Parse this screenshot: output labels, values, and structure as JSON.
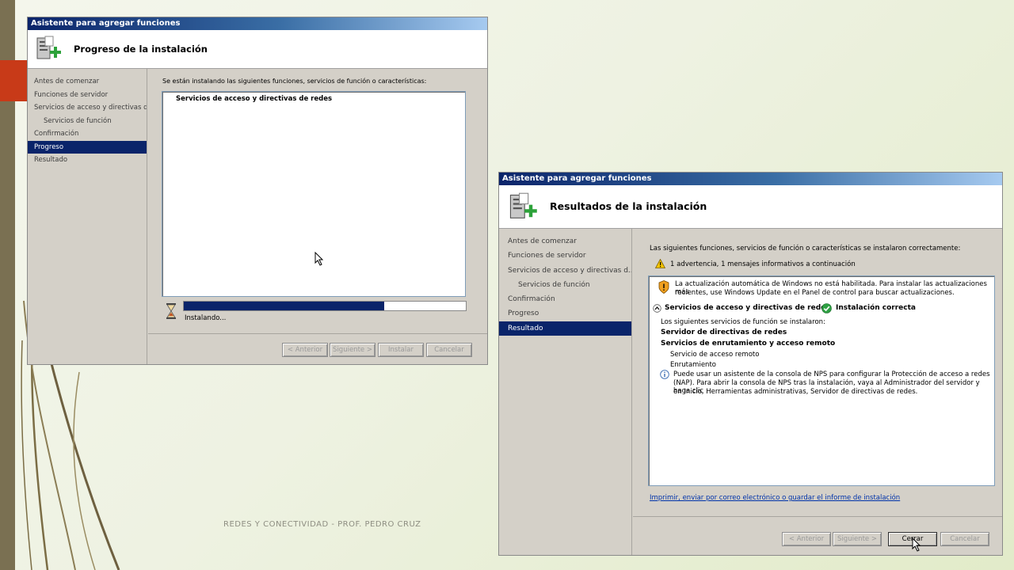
{
  "slide": {
    "footer": "REDES Y CONECTIVIDAD - PROF. PEDRO CRUZ"
  },
  "progress_window": {
    "title": "Asistente para agregar funciones",
    "header": "Progreso de la instalación",
    "nav": [
      {
        "label": "Antes de comenzar"
      },
      {
        "label": "Funciones de servidor"
      },
      {
        "label": "Servicios de acceso y directivas d..."
      },
      {
        "label": "Servicios de función"
      },
      {
        "label": "Confirmación"
      },
      {
        "label": "Progreso"
      },
      {
        "label": "Resultado"
      }
    ],
    "intro": "Se están instalando las siguientes funciones, servicios de función o características:",
    "list_item": "Servicios de acceso y directivas de redes",
    "progress": 0.71,
    "status": "Instalando...",
    "buttons": {
      "back": "< Anterior",
      "next": "Siguiente >",
      "install": "Instalar",
      "cancel": "Cancelar"
    }
  },
  "results_window": {
    "title": "Asistente para agregar funciones",
    "header": "Resultados de la instalación",
    "nav": [
      {
        "label": "Antes de comenzar"
      },
      {
        "label": "Funciones de servidor"
      },
      {
        "label": "Servicios de acceso y directivas d..."
      },
      {
        "label": "Servicios de función"
      },
      {
        "label": "Confirmación"
      },
      {
        "label": "Progreso"
      },
      {
        "label": "Resultado"
      }
    ],
    "intro": "Las siguientes funciones, servicios de función o características se instalaron correctamente:",
    "summary": "1 advertencia, 1 mensajes informativos a continuación",
    "warning_line1": "La actualización automática de Windows no está habilitada. Para instalar las actualizaciones más",
    "warning_line2": "recientes, use Windows Update en el Panel de control para buscar actualizaciones.",
    "section_title": "Servicios de acceso y directivas de redes",
    "section_status": "Instalación correcta",
    "installed_intro": "Los siguientes servicios de función se instalaron:",
    "service_1": "Servidor de directivas de redes",
    "service_2": "Servicios de enrutamiento y acceso remoto",
    "sub_1": "Servicio de acceso remoto",
    "sub_2": "Enrutamiento",
    "info_line1": "Puede usar un asistente de la consola de NPS para configurar la Protección de acceso a redes",
    "info_line2": "(NAP). Para abrir la consola de NPS tras la instalación, vaya al Administrador del servidor y haga clic",
    "info_line3": "en Inicio, Herramientas administrativas, Servidor de directivas de redes.",
    "report_link": "Imprimir, enviar por correo electrónico o guardar el informe de instalación",
    "buttons": {
      "back": "< Anterior",
      "next": "Siguiente >",
      "close": "Cerrar",
      "cancel": "Cancelar"
    }
  }
}
